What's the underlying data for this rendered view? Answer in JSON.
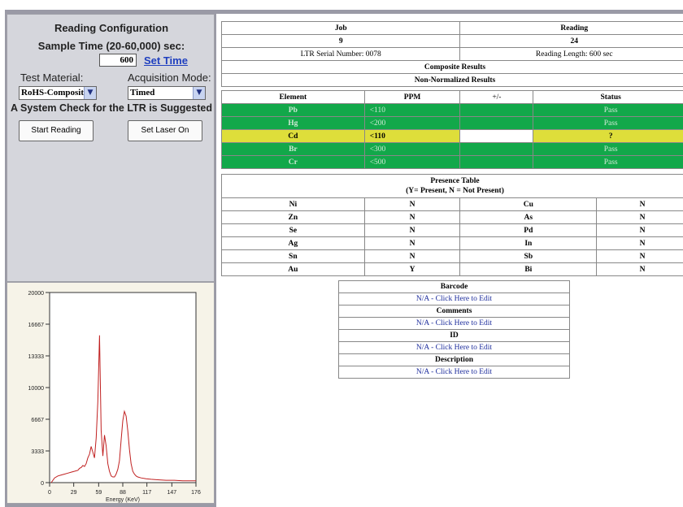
{
  "config": {
    "title": "Reading Configuration",
    "sample_time_label": "Sample Time (20-60,000) sec:",
    "sample_time_value": "600",
    "set_time_link": "Set Time",
    "test_material_label": "Test Material:",
    "test_material_value": "RoHS-Composite",
    "acquisition_mode_label": "Acquisition Mode:",
    "acquisition_mode_value": "Timed",
    "system_check_notice": "A System Check for the LTR is Suggested",
    "start_reading_button": "Start Reading",
    "set_laser_button": "Set Laser On"
  },
  "spectrum": {
    "y_ticks": [
      "20000",
      "16667",
      "13333",
      "10000",
      "6667",
      "3333",
      "0"
    ],
    "x_ticks": [
      "0",
      "29",
      "59",
      "88",
      "117",
      "147",
      "176"
    ],
    "x_label": "Energy (KeV)",
    "line_color": "#c02020",
    "chart_data": {
      "type": "line",
      "xlabel": "Energy (KeV)",
      "ylabel": "",
      "xlim": [
        0,
        176
      ],
      "ylim": [
        0,
        20000
      ],
      "series": [
        {
          "values_x": [
            2,
            6,
            10,
            14,
            18,
            22,
            26,
            30,
            34,
            36,
            38,
            40,
            42,
            44,
            46,
            48,
            50,
            52,
            54,
            56,
            58,
            60,
            62,
            64,
            66,
            68,
            70,
            72,
            74,
            76,
            78,
            80,
            82,
            84,
            86,
            88,
            90,
            92,
            94,
            96,
            98,
            100,
            102,
            104,
            106,
            110,
            116,
            122,
            130,
            140,
            150,
            160,
            170,
            176
          ],
          "values_y": [
            0,
            500,
            700,
            800,
            900,
            1000,
            1100,
            1200,
            1300,
            1500,
            1600,
            1800,
            1700,
            2000,
            2600,
            3000,
            3800,
            3200,
            2600,
            4700,
            8500,
            15500,
            5500,
            2800,
            5000,
            3900,
            2000,
            1200,
            700,
            600,
            600,
            900,
            1400,
            2300,
            4500,
            6500,
            7500,
            7000,
            5500,
            3500,
            2000,
            1200,
            900,
            700,
            600,
            500,
            400,
            350,
            300,
            250,
            250,
            200,
            200,
            200
          ]
        }
      ]
    }
  },
  "summary": {
    "job_label": "Job",
    "reading_label": "Reading",
    "job_value": "9",
    "reading_value": "24",
    "serial": "LTR Serial Number: 0078",
    "reading_length": "Reading Length: 600 sec",
    "composite_results": "Composite Results",
    "non_normalized": "Non-Normalized Results"
  },
  "results_table": {
    "headers": [
      "Element",
      "PPM",
      "+/-",
      "Status"
    ],
    "rows": [
      {
        "element": "Pb",
        "ppm": "<110",
        "err": "",
        "status": "Pass",
        "color": "green"
      },
      {
        "element": "Hg",
        "ppm": "<200",
        "err": "",
        "status": "Pass",
        "color": "green"
      },
      {
        "element": "Cd",
        "ppm": "<110",
        "err": "",
        "status": "?",
        "color": "yellow"
      },
      {
        "element": "Br",
        "ppm": "<300",
        "err": "",
        "status": "Pass",
        "color": "green"
      },
      {
        "element": "Cr",
        "ppm": "<500",
        "err": "",
        "status": "Pass",
        "color": "green"
      }
    ],
    "status_colors": {
      "green": "#12a84a",
      "yellow": "#dede3a"
    }
  },
  "presence_table": {
    "title": "Presence Table",
    "legend": "(Y= Present, N = Not Present)",
    "rows": [
      [
        "Ni",
        "N",
        "Cu",
        "N"
      ],
      [
        "Zn",
        "N",
        "As",
        "N"
      ],
      [
        "Se",
        "N",
        "Pd",
        "N"
      ],
      [
        "Ag",
        "N",
        "In",
        "N"
      ],
      [
        "Sn",
        "N",
        "Sb",
        "N"
      ],
      [
        "Au",
        "Y",
        "Bi",
        "N"
      ]
    ]
  },
  "metadata_table": {
    "barcode_label": "Barcode",
    "barcode_value": "N/A - Click Here to Edit",
    "comments_label": "Comments",
    "comments_value": "N/A - Click Here to Edit",
    "id_label": "ID",
    "id_value": "N/A - Click Here to Edit",
    "description_label": "Description",
    "description_value": "N/A - Click Here to Edit"
  }
}
